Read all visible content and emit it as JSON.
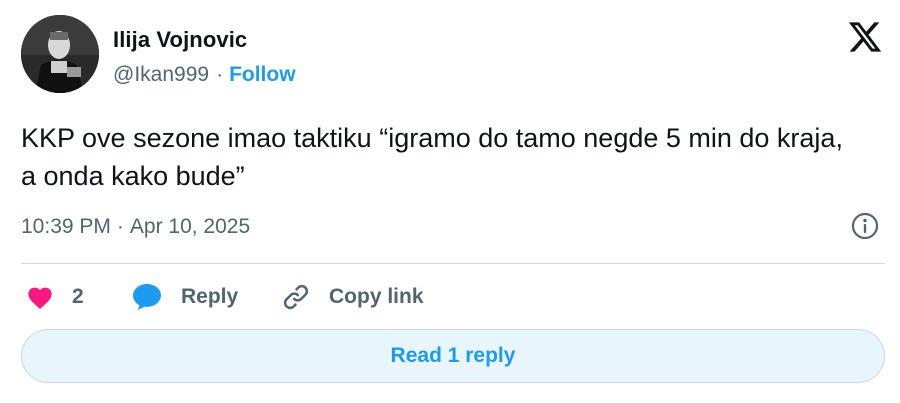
{
  "author": {
    "name": "Ilija Vojnovic",
    "handle": "@Ikan999",
    "separator": "·",
    "follow_label": "Follow"
  },
  "tweet": {
    "text": "KKP ove sezone imao taktiku “igramo do tamo negde 5 min do kraja, a onda kako bude”",
    "time": "10:39 PM",
    "separator": "·",
    "date": "Apr 10, 2025"
  },
  "actions": {
    "like_count": "2",
    "reply_label": "Reply",
    "copy_link_label": "Copy link"
  },
  "read_replies_label": "Read 1 reply",
  "icons": {
    "brand": "x-logo-icon",
    "info": "info-icon",
    "like": "heart-icon",
    "reply": "speech-bubble-icon",
    "copy_link": "link-icon"
  },
  "colors": {
    "accent": "#1d9bf0",
    "like": "#f91880",
    "text_primary": "#0f1419",
    "text_secondary": "#536471",
    "divider": "#cfd9de",
    "button_bg": "#e8f5fd"
  }
}
